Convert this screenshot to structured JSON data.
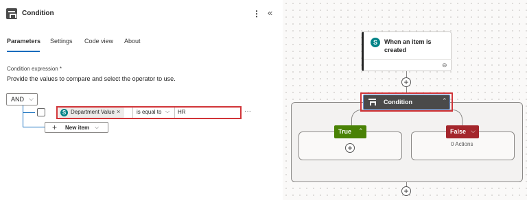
{
  "panel": {
    "title": "Condition",
    "more_glyph": "⋮",
    "collapse_glyph": "«",
    "tabs": [
      {
        "label": "Parameters",
        "active": true
      },
      {
        "label": "Settings",
        "active": false
      },
      {
        "label": "Code view",
        "active": false
      },
      {
        "label": "About",
        "active": false
      }
    ],
    "expression_label": "Condition expression *",
    "expression_help": "Provide the values to compare and select the operator to use.",
    "group_operator": "AND",
    "row": {
      "token_label": "Department Value",
      "token_remove": "×",
      "operator": "is equal to",
      "value": "HR",
      "more_glyph": "···"
    },
    "new_item_plus": "+",
    "new_item_label": "New item",
    "chevron": "⌵"
  },
  "canvas": {
    "trigger": {
      "title": "When an item is created",
      "link_glyph": "⊖"
    },
    "plus_glyph": "+",
    "condition_node": {
      "label": "Condition",
      "chevron": "⌃"
    },
    "true_branch": {
      "label": "True",
      "chevron": "⌃"
    },
    "false_branch": {
      "label": "False",
      "chevron": "⌵",
      "actions_text": "0 Actions"
    }
  },
  "colors": {
    "accent": "#0f6cbd",
    "highlight": "#d13438",
    "true_green": "#498205",
    "false_red": "#a4262c",
    "node_dark": "#4a4a4a",
    "sharepoint_teal": "#038387"
  },
  "icons": [
    "condition-icon",
    "more-vertical-icon",
    "collapse-icon",
    "sharepoint-icon",
    "chevron-down-icon",
    "chevron-up-icon",
    "plus-icon",
    "close-icon",
    "link-icon"
  ]
}
